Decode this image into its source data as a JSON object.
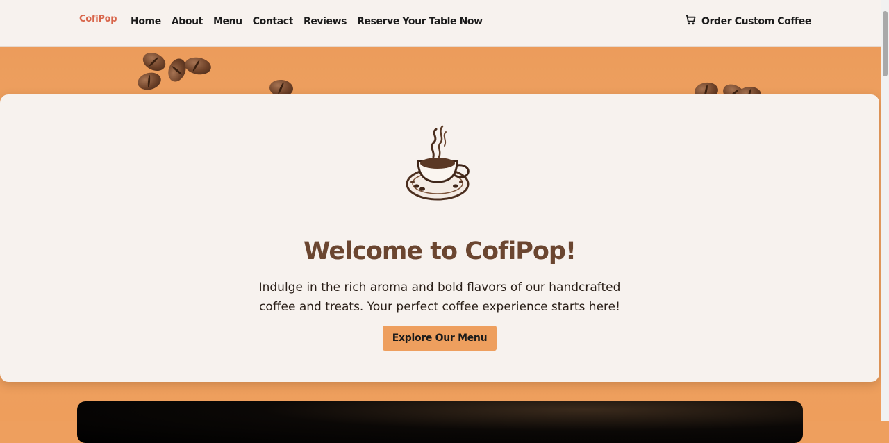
{
  "brand": {
    "logo_text": "CofiPop",
    "accent_color": "#ee9f5e",
    "logo_color": "#d8654a"
  },
  "nav": {
    "links": [
      "Home",
      "About",
      "Menu",
      "Contact",
      "Reviews",
      "Reserve Your Table Now"
    ],
    "order_label": "Order Custom Coffee",
    "order_icon": "cart-icon"
  },
  "hero": {
    "title": "Welcome to CofiPop!",
    "description": "Indulge in the rich aroma and bold flavors of our handcrafted coffee and treats. Your perfect coffee experience starts here!",
    "cta_label": "Explore Our Menu",
    "icon": "coffee-cup-icon"
  }
}
